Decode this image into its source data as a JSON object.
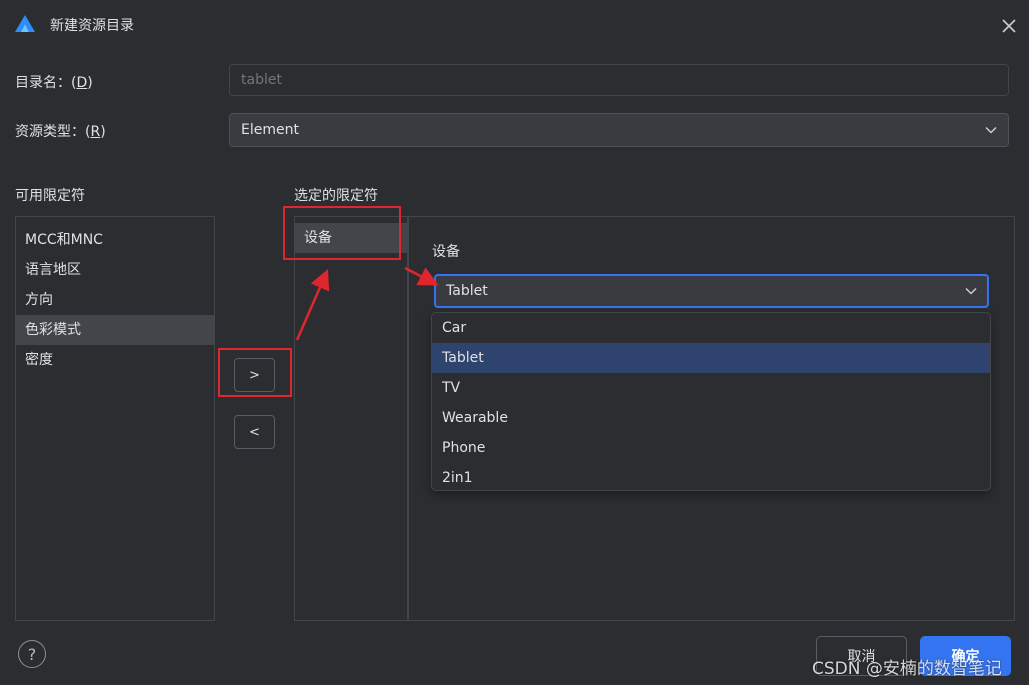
{
  "window": {
    "title": "新建资源目录"
  },
  "form": {
    "dir_label": "目录名：",
    "dir_mnemonic": "D",
    "dir_placeholder": "tablet",
    "type_label": "资源类型：",
    "type_mnemonic": "R",
    "type_value": "Element"
  },
  "available": {
    "heading": "可用限定符",
    "items": [
      "MCC和MNC",
      "语言地区",
      "方向",
      "色彩模式",
      "密度"
    ],
    "selected_index": 3
  },
  "chosen": {
    "heading": "选定的限定符",
    "items": [
      "设备"
    ]
  },
  "buttons": {
    "add": ">",
    "remove": "<",
    "help": "?",
    "cancel": "取消",
    "ok": "确定"
  },
  "device": {
    "label": "设备",
    "value": "Tablet",
    "options": [
      "Car",
      "Tablet",
      "TV",
      "Wearable",
      "Phone",
      "2in1"
    ],
    "highlighted_index": 1
  },
  "watermark": "CSDN @安楠的数智笔记",
  "colors": {
    "background": "#2b2d30",
    "accent": "#3574f0",
    "highlight": "#2e436e",
    "annotation": "#e0262d"
  }
}
